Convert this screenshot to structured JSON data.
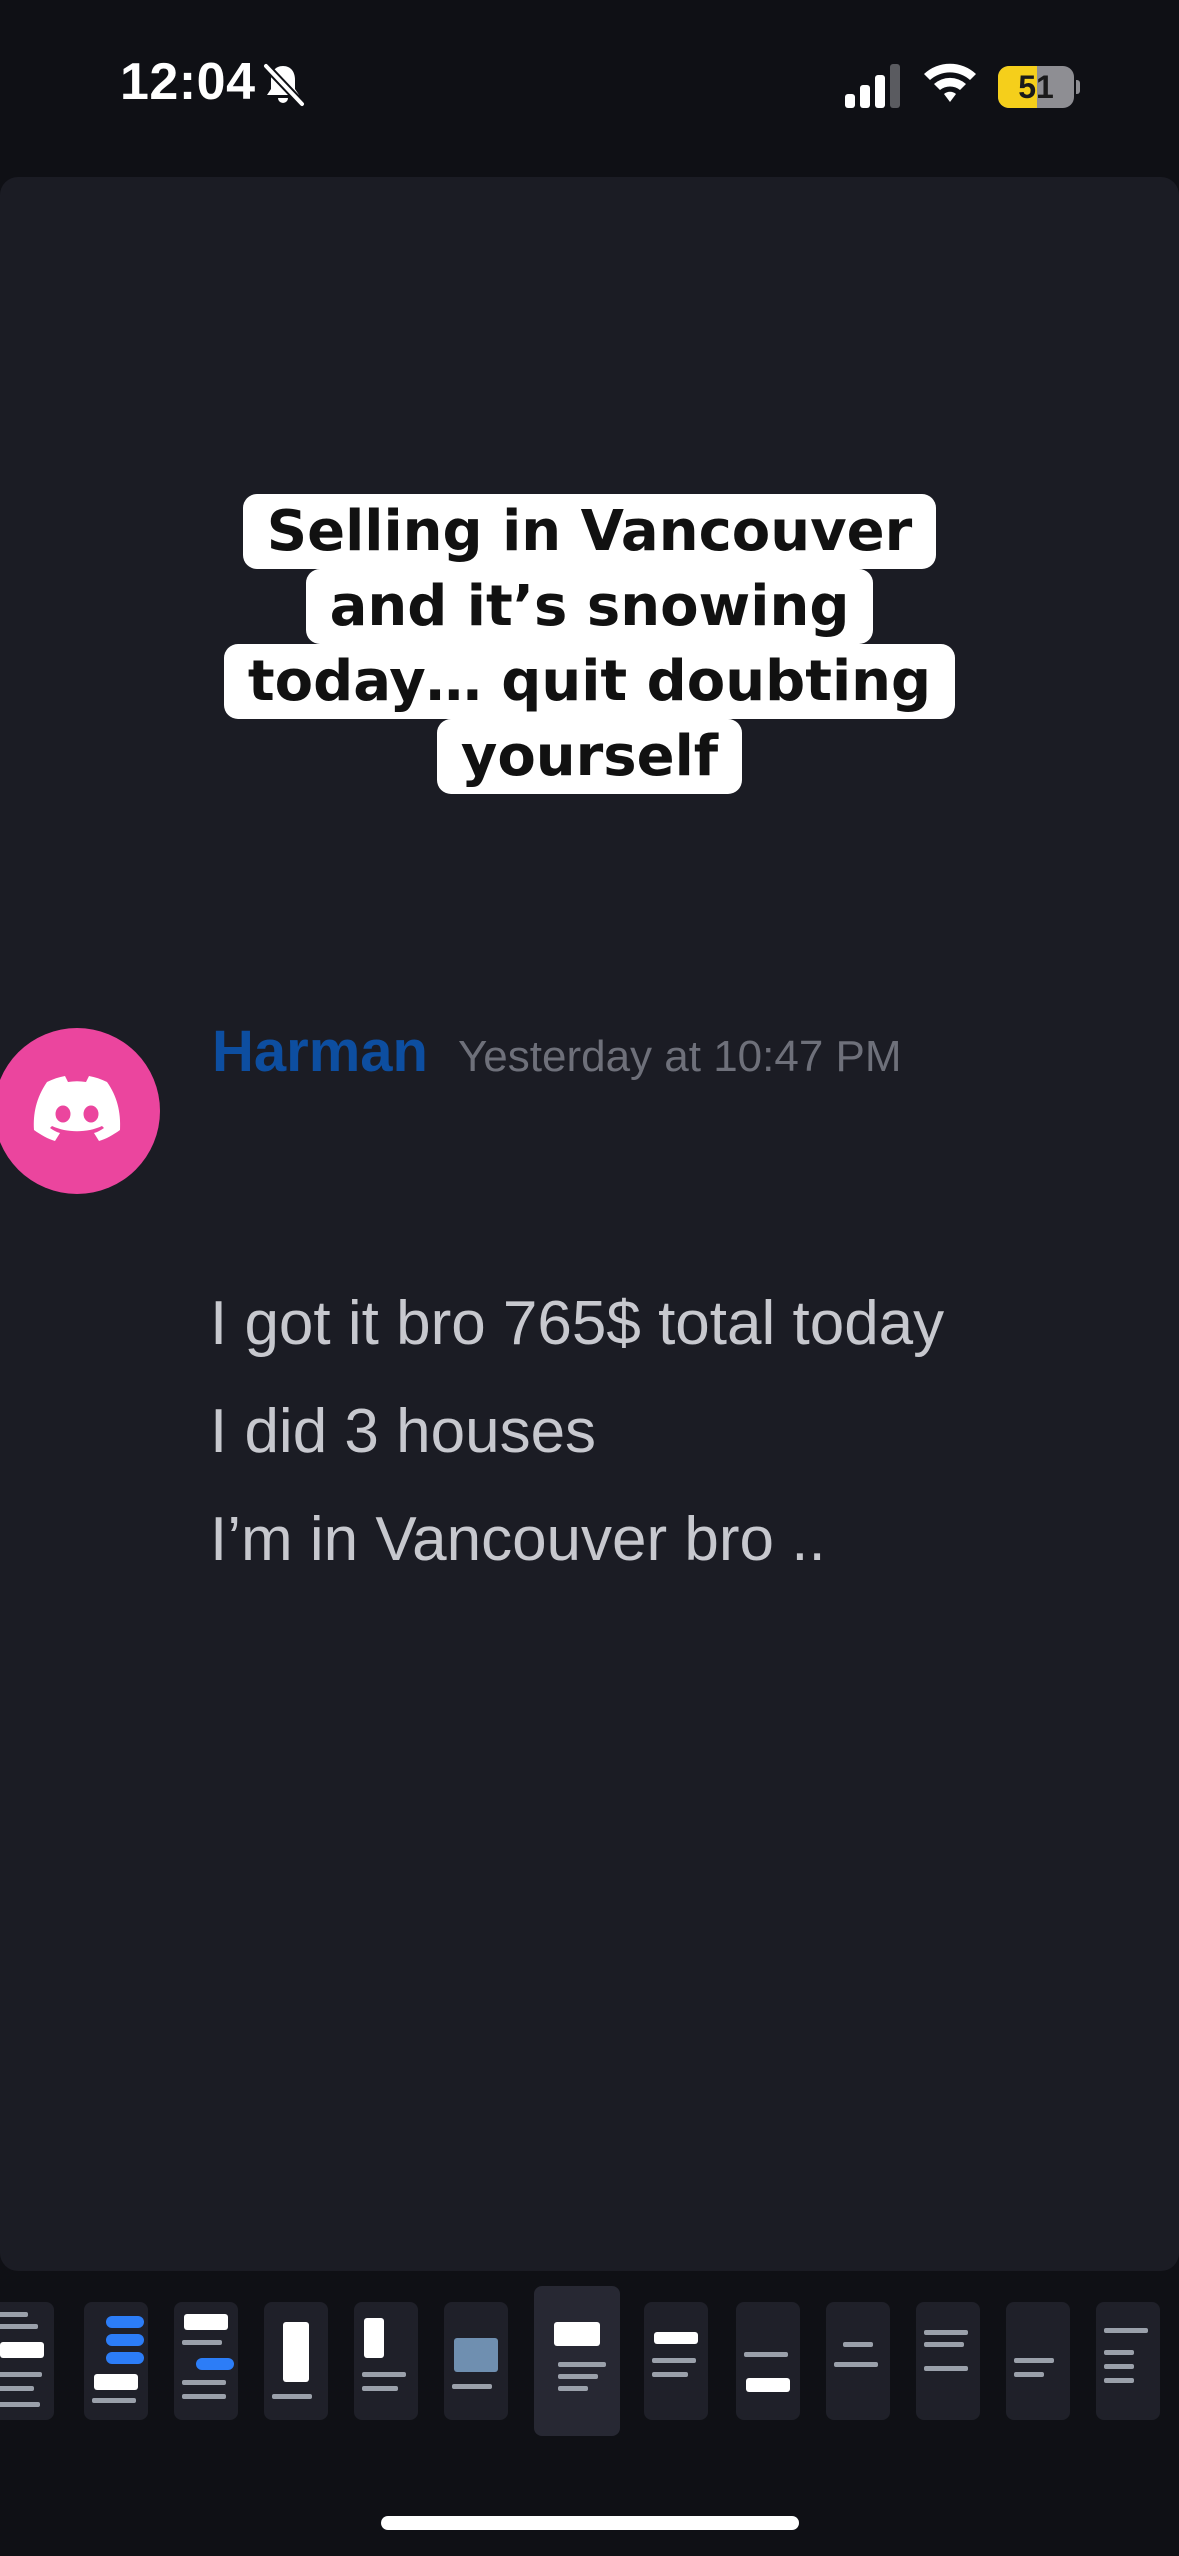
{
  "status_bar": {
    "time": "12:04",
    "battery_level": "51",
    "battery_fraction": 0.51,
    "icons": [
      "bell-slash-icon",
      "signal-icon",
      "wifi-icon",
      "battery-icon"
    ]
  },
  "caption": {
    "lines": [
      "Selling in Vancouver",
      "and it’s snowing",
      "today… quit doubting",
      "yourself"
    ]
  },
  "message": {
    "avatar_icon": "discord-logo-icon",
    "avatar_color": "#eb459e",
    "username": "Harman",
    "username_color": "#0d4ea0",
    "timestamp": "Yesterday at 10:47 PM",
    "lines": [
      "I got it bro 765$ total today",
      "I did 3 houses",
      "I’m in Vancouver bro .."
    ]
  },
  "thumbnail_strip": {
    "count": 13,
    "selected_index": 6
  }
}
